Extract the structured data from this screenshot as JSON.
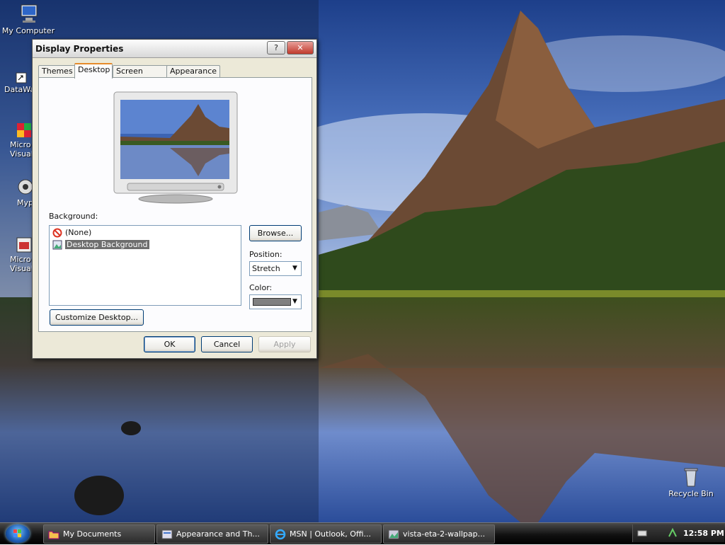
{
  "desktop": {
    "icons": [
      {
        "name": "My Computer",
        "icon": "computer-icon"
      },
      {
        "name": "DataWa",
        "icon": "shortcut-icon"
      },
      {
        "name": "Micro Visual",
        "icon": "program-shortcut-icon"
      },
      {
        "name": "Myp",
        "icon": "program-icon"
      },
      {
        "name": "Micro Visual",
        "icon": "program-shortcut-icon"
      },
      {
        "name": "Recycle Bin",
        "icon": "recycle-bin-icon"
      }
    ]
  },
  "dialog": {
    "title": "Display Properties",
    "help_label": "?",
    "close_label": "✕",
    "tabs": [
      "Themes",
      "Desktop",
      "Screen Saver",
      "Appearance"
    ],
    "active_tab": "Desktop",
    "background_label": "Background:",
    "background_items": [
      {
        "label": "(None)",
        "icon": "none-icon"
      },
      {
        "label": "Desktop Background",
        "icon": "image-file-icon",
        "selected": true
      }
    ],
    "browse_label": "Browse...",
    "position_label": "Position:",
    "position_value": "Stretch",
    "color_label": "Color:",
    "color_value": "#808080",
    "customize_label": "Customize Desktop...",
    "ok_label": "OK",
    "cancel_label": "Cancel",
    "apply_label": "Apply"
  },
  "taskbar": {
    "tasks": [
      {
        "label": "My Documents",
        "icon": "folder-icon"
      },
      {
        "label": "Appearance and Th...",
        "icon": "control-panel-icon"
      },
      {
        "label": "MSN | Outlook, Offi...",
        "icon": "internet-explorer-icon"
      },
      {
        "label": "vista-eta-2-wallpap...",
        "icon": "image-icon"
      }
    ],
    "clock": "12:58 PM"
  }
}
